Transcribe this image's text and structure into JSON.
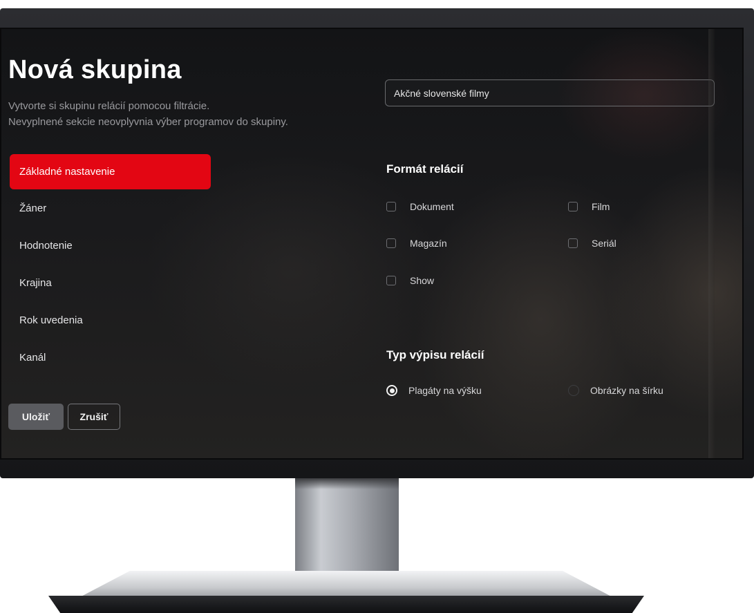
{
  "page": {
    "title": "Nová skupina",
    "subtitle_line1": "Vytvorte si skupinu relácií pomocou filtrácie.",
    "subtitle_line2": "Nevyplnené sekcie neovplyvnia výber programov do skupiny."
  },
  "nav": {
    "items": [
      {
        "label": "Základné nastavenie",
        "active": true
      },
      {
        "label": "Žáner",
        "active": false
      },
      {
        "label": "Hodnotenie",
        "active": false
      },
      {
        "label": "Krajina",
        "active": false
      },
      {
        "label": "Rok uvedenia",
        "active": false
      },
      {
        "label": "Kanál",
        "active": false
      }
    ]
  },
  "actions": {
    "save_label": "Uložiť",
    "cancel_label": "Zrušiť"
  },
  "name_input": {
    "value": "Akčné slovenské filmy"
  },
  "format": {
    "title": "Formát relácií",
    "options": [
      {
        "label": "Dokument",
        "checked": false
      },
      {
        "label": "Film",
        "checked": false
      },
      {
        "label": "Magazín",
        "checked": false
      },
      {
        "label": "Seriál",
        "checked": false
      },
      {
        "label": "Show",
        "checked": false
      }
    ]
  },
  "listing": {
    "title": "Typ výpisu relácií",
    "options": [
      {
        "label": "Plagáty na výšku",
        "selected": true
      },
      {
        "label": "Obrázky na šírku",
        "selected": false
      }
    ]
  },
  "colors": {
    "accent": "#e30613",
    "background": "#151618",
    "text": "#ffffff",
    "muted": "#9a9a9e"
  }
}
